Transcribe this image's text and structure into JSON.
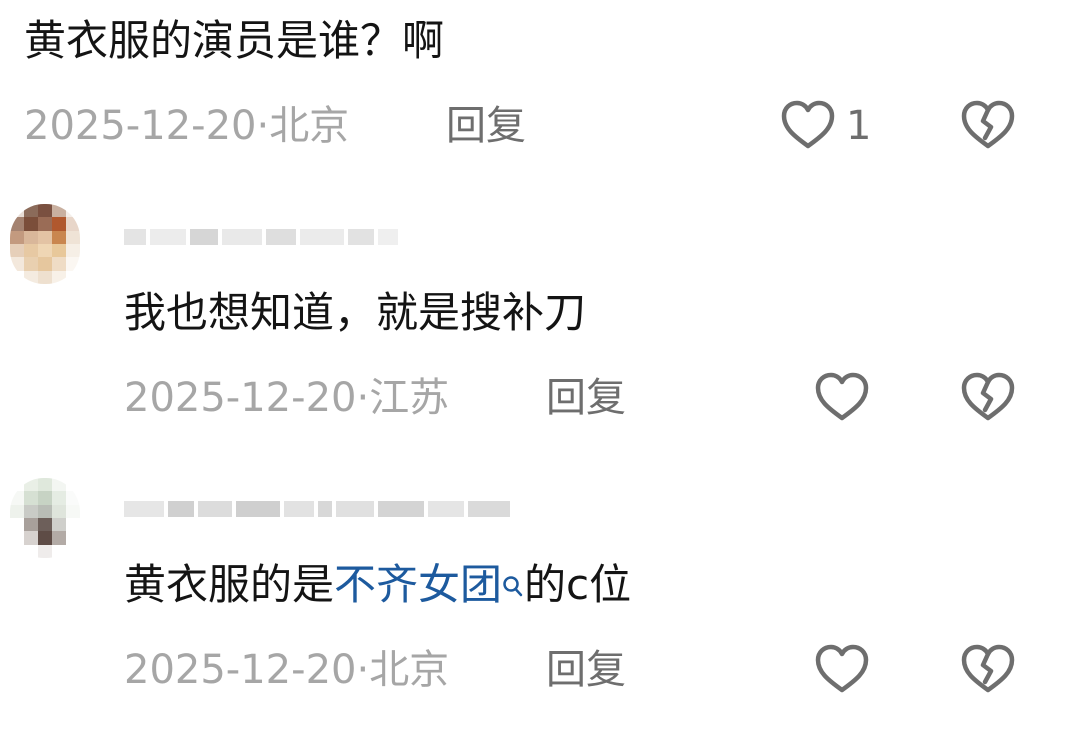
{
  "comments": [
    {
      "text": "黄衣服的演员是谁？啊",
      "date": "2025-12-20",
      "location": "北京",
      "reply_label": "回复",
      "like_count": "1"
    },
    {
      "text": "我也想知道，就是搜补刀",
      "date": "2025-12-20",
      "location": "江苏",
      "reply_label": "回复"
    },
    {
      "text_prefix": "黄衣服的是",
      "link_text": "不齐女团",
      "text_suffix": "的c位",
      "date": "2025-12-20",
      "location": "北京",
      "reply_label": "回复"
    }
  ],
  "separator": "·",
  "icons": {
    "like": "heart-outline-icon",
    "dislike": "broken-heart-icon",
    "link_search": "search-icon"
  },
  "colors": {
    "text": "#141414",
    "meta": "#a6a6a6",
    "action": "#6e6e6e",
    "link": "#1d5a9e"
  }
}
